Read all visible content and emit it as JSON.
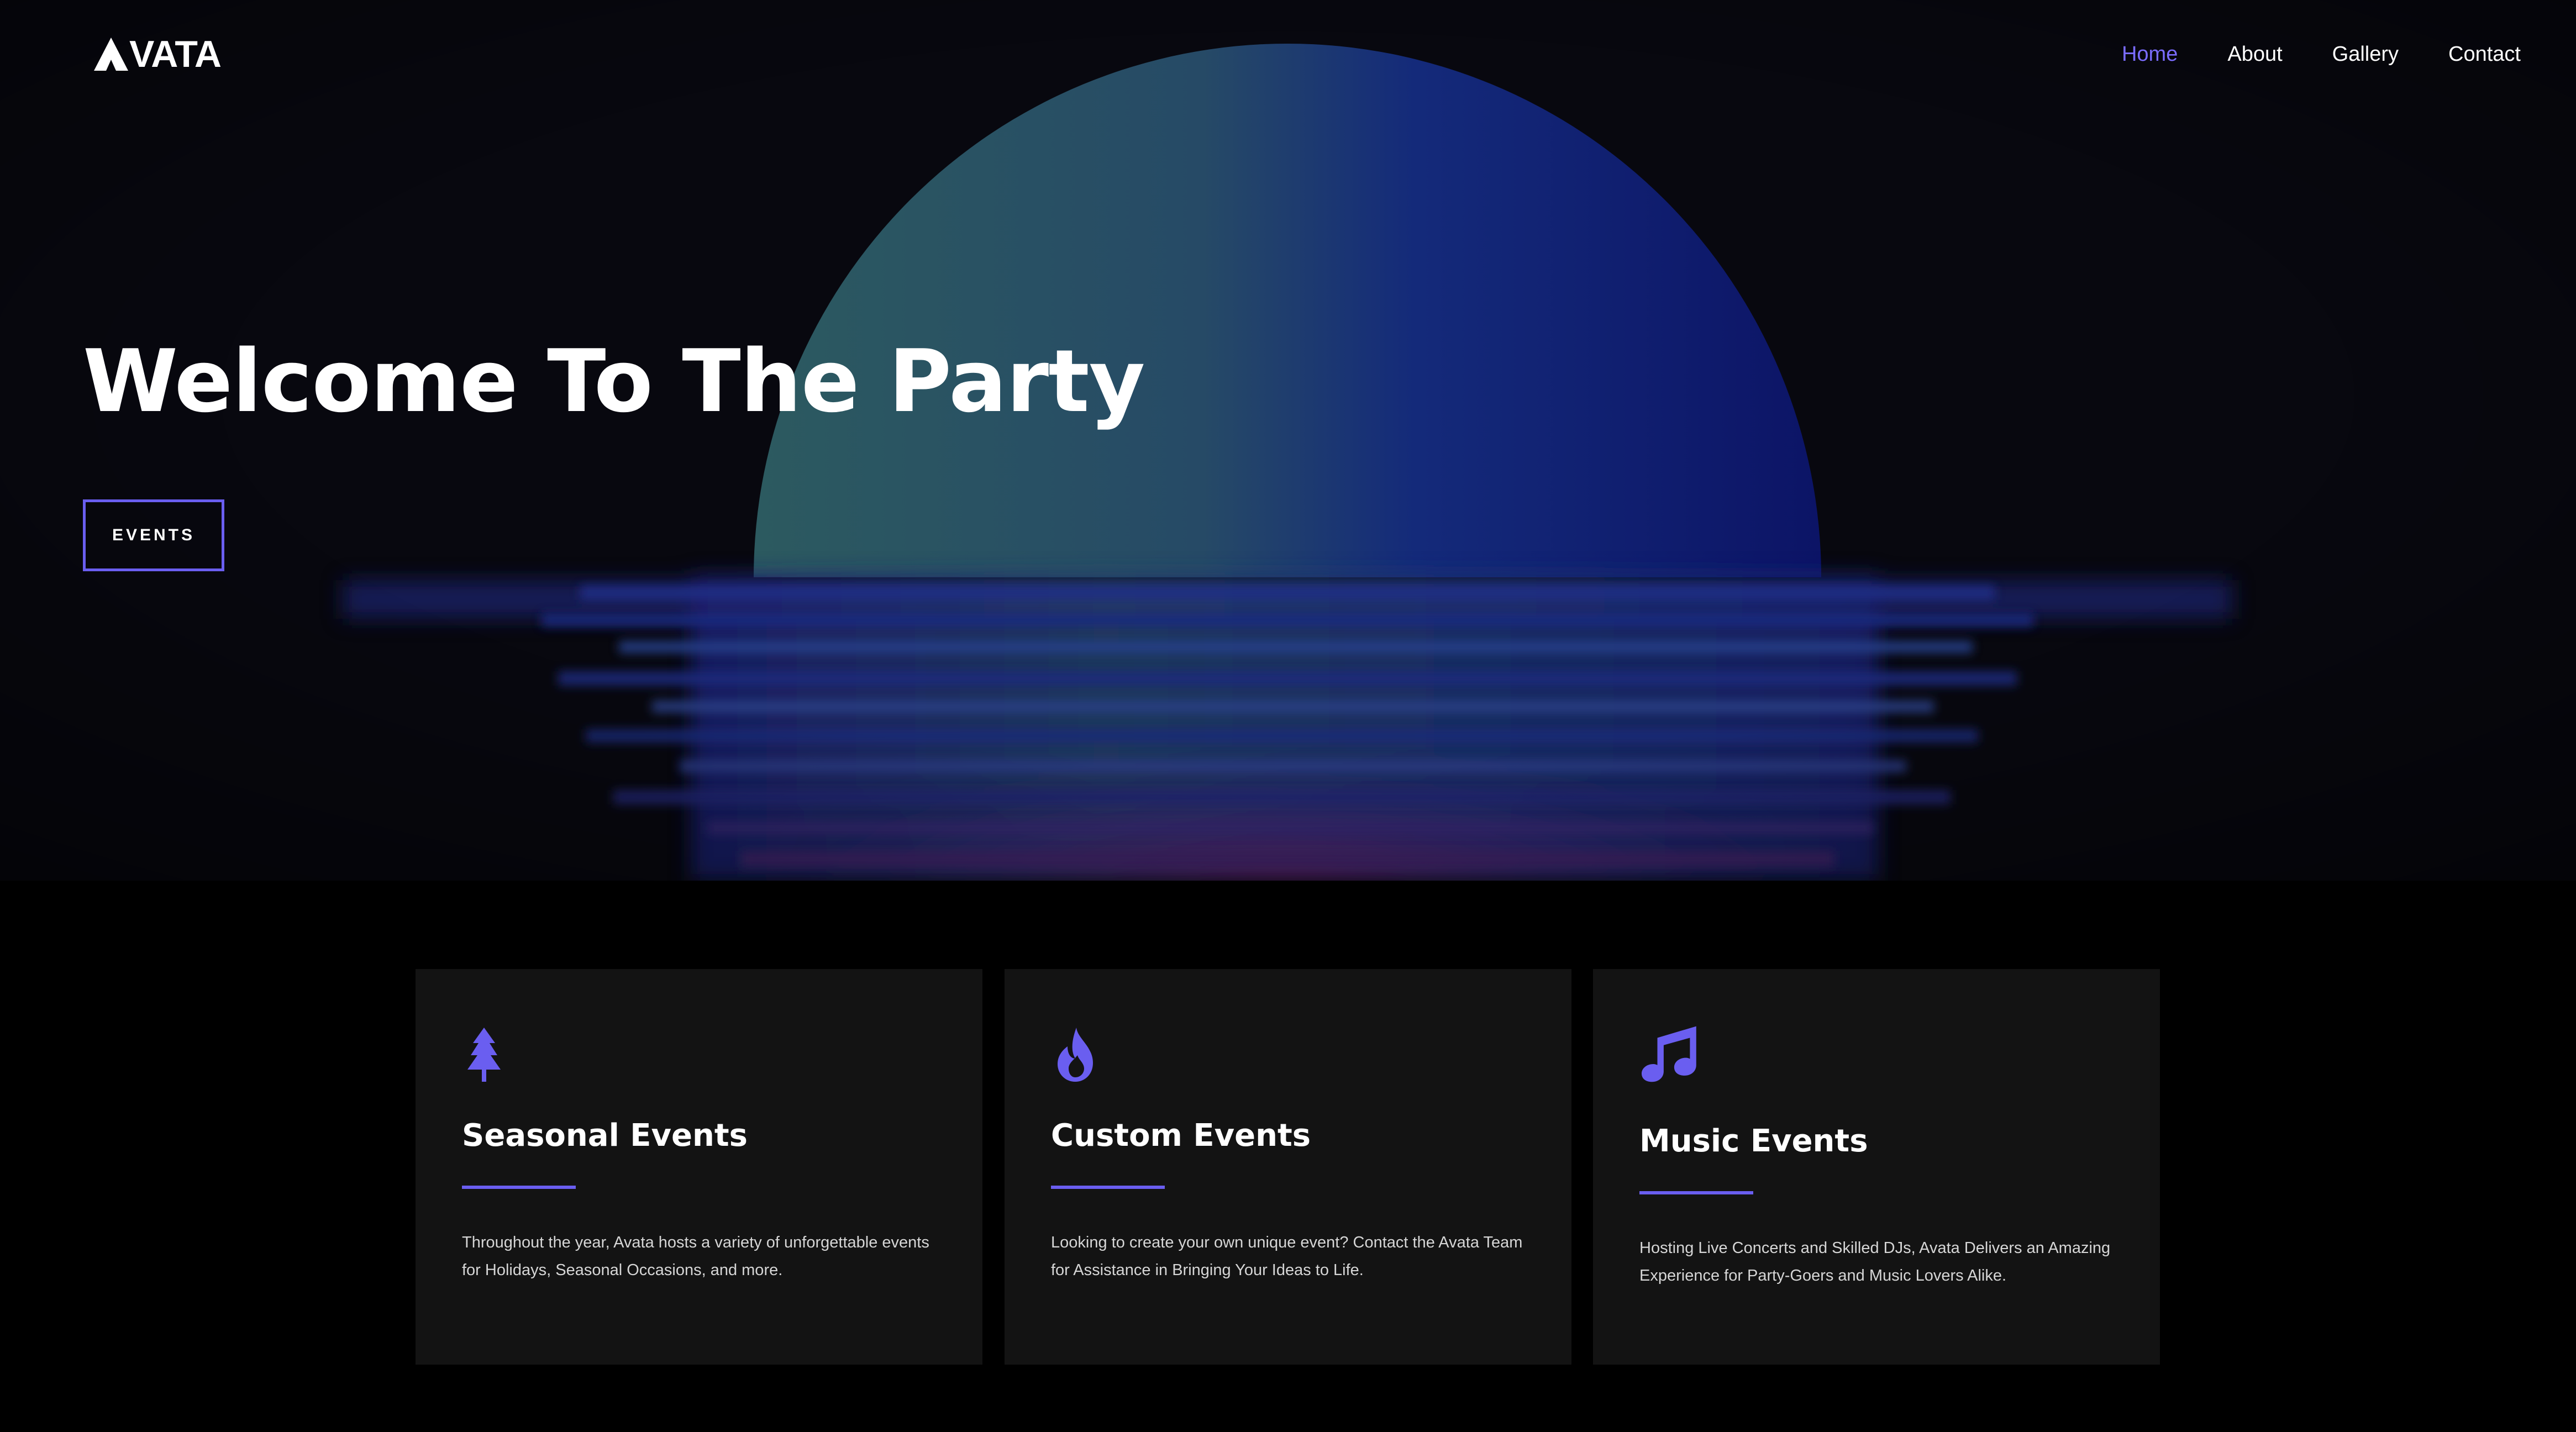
{
  "brand": {
    "logo_text": "VATA",
    "accent_color": "#6a5ef0"
  },
  "nav": {
    "items": [
      {
        "label": "Home",
        "active": true
      },
      {
        "label": "About",
        "active": false
      },
      {
        "label": "Gallery",
        "active": false
      },
      {
        "label": "Contact",
        "active": false
      }
    ]
  },
  "hero": {
    "title": "Welcome To The Party",
    "button_label": "EVENTS"
  },
  "cards": [
    {
      "icon": "tree-icon",
      "title": "Seasonal Events",
      "text": "Throughout the year, Avata hosts a variety of unforgettable events for Holidays, Seasonal Occasions, and more."
    },
    {
      "icon": "flame-icon",
      "title": "Custom Events",
      "text": "Looking to create your own unique event? Contact the Avata Team for Assistance in Bringing Your Ideas to Life."
    },
    {
      "icon": "music-note-icon",
      "title": "Music Events",
      "text": "Hosting Live Concerts and Skilled DJs, Avata Delivers an Amazing Experience for Party-Goers and Music Lovers Alike."
    }
  ]
}
